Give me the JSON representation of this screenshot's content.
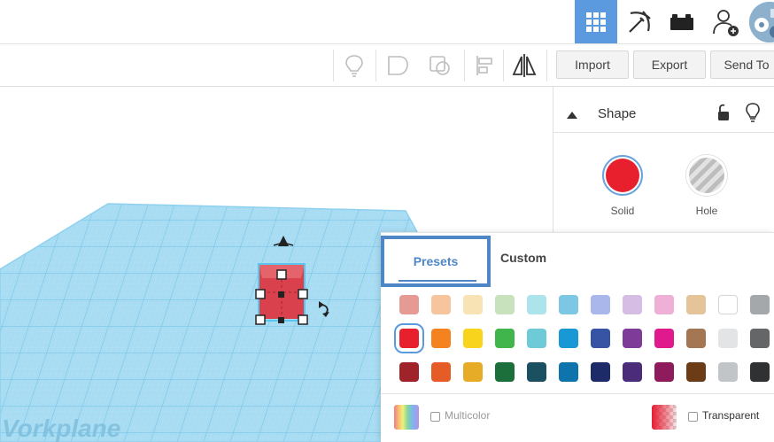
{
  "topbar": {
    "icons": [
      "grid-view-icon",
      "pickaxe-icon",
      "bricks-icon",
      "add-user-icon"
    ],
    "active_color": "#5b9ade"
  },
  "toolbar": {
    "icons": [
      "light-bulb-icon",
      "group-icon",
      "ungroup-icon",
      "align-icon",
      "mirror-icon"
    ],
    "import_label": "Import",
    "export_label": "Export",
    "sendto_label": "Send To"
  },
  "shape_panel": {
    "title": "Shape",
    "solid_label": "Solid",
    "hole_label": "Hole",
    "solid_color": "#e8202d"
  },
  "workplane": {
    "label": "Vorkplane",
    "grid_color": "#8fd0ef",
    "shape_color": "#d9414c"
  },
  "color_picker": {
    "tab_presets": "Presets",
    "tab_custom": "Custom",
    "selected_color": "#e8202d",
    "rows": [
      [
        "#e59b93",
        "#f6c59d",
        "#f8e3b4",
        "#c7e2bc",
        "#ace4ec",
        "#7cc7e3",
        "#a9b7ea",
        "#d5bde4",
        "#efb0d7",
        "#e5c499",
        "#ffffff",
        "#a5a8ab"
      ],
      [
        "#e8202d",
        "#f3821f",
        "#f8d51c",
        "#3fb54c",
        "#6fcad8",
        "#1899d6",
        "#3753a4",
        "#7e3b98",
        "#e0198d",
        "#a47752",
        "#e2e4e6",
        "#646668"
      ],
      [
        "#a0232a",
        "#e65c26",
        "#e6ac27",
        "#1c6e3a",
        "#1b5060",
        "#0e74ab",
        "#1d2c69",
        "#4b2c7b",
        "#8e1c5d",
        "#6b3c16",
        "#c2c5c8",
        "#303133"
      ]
    ],
    "multicolor_label": "Multicolor",
    "transparent_label": "Transparent"
  }
}
